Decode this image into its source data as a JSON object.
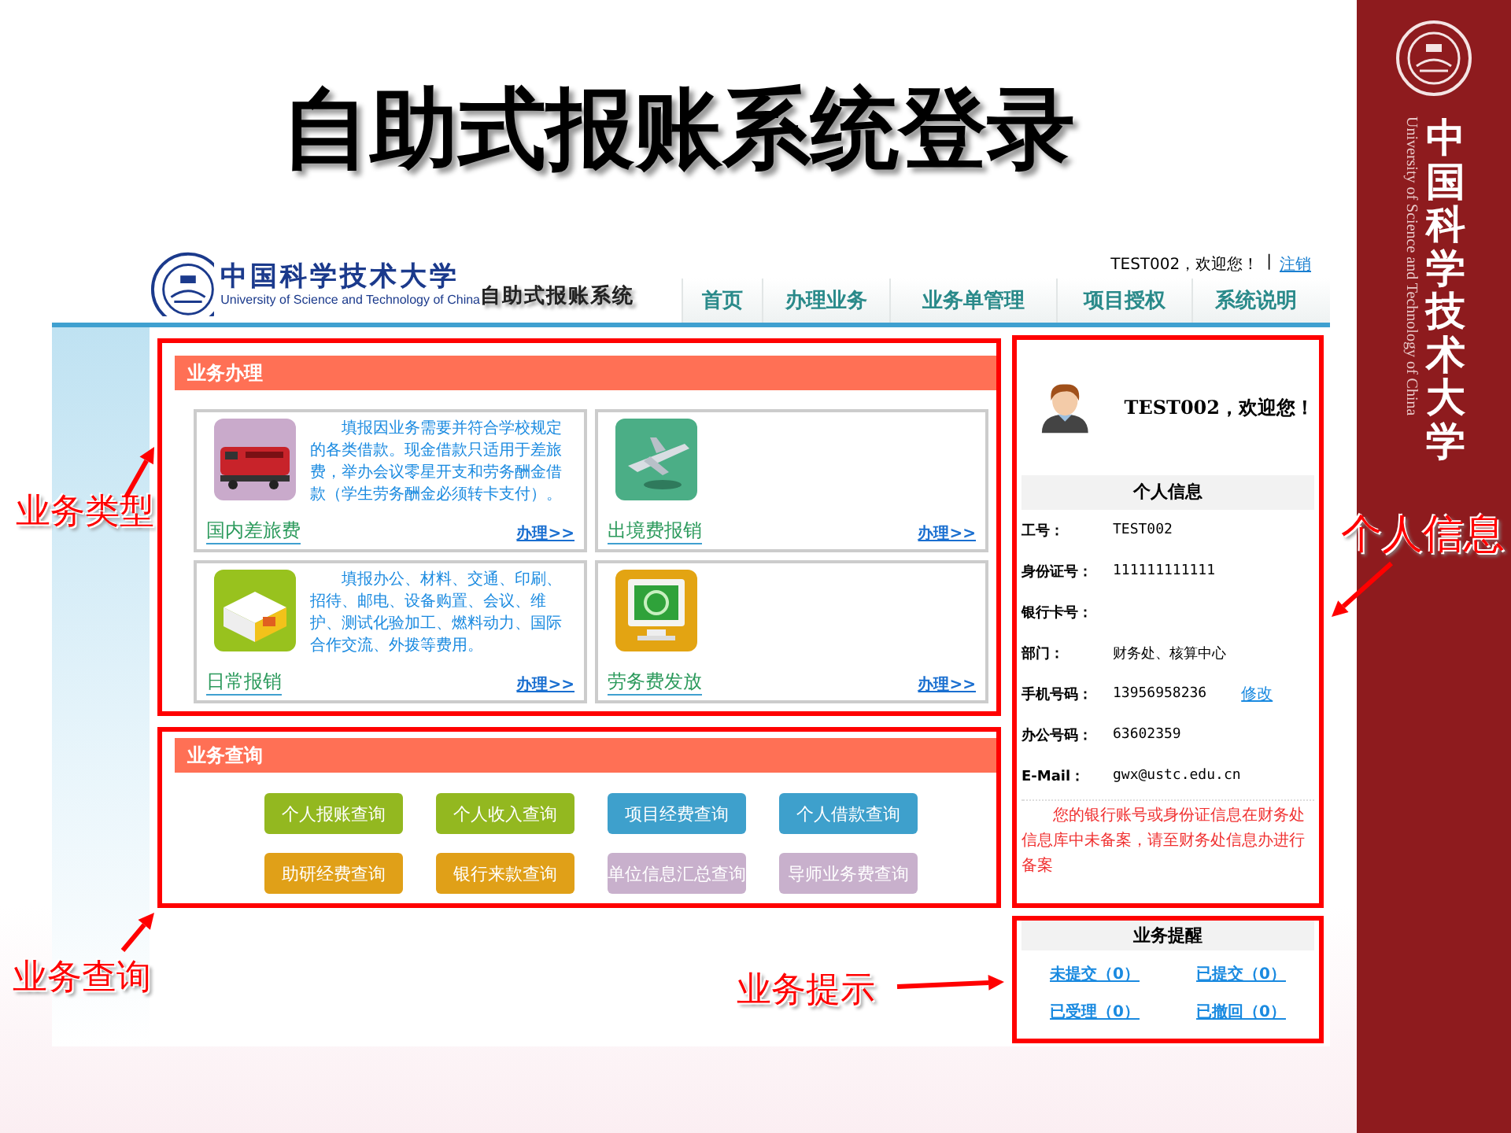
{
  "slide": {
    "title": "自助式报账系统登录"
  },
  "side_band": {
    "university_cn": "中国科学技术大学",
    "university_en": "University of Science and Technology of China"
  },
  "header": {
    "logo_cn": "中国科学技术大学",
    "logo_en": "University of Science and Technology of China",
    "system_name": "自助式报账系统",
    "user_greeting": "TEST002，欢迎您！",
    "separator": "|",
    "logout_link": "注销",
    "nav": [
      {
        "label": "首页"
      },
      {
        "label": "办理业务"
      },
      {
        "label": "业务单管理"
      },
      {
        "label": "项目授权"
      },
      {
        "label": "系统说明"
      }
    ]
  },
  "business_panel": {
    "title": "业务办理",
    "cards": [
      {
        "kind": "train",
        "title": "国内差旅费",
        "description": "填报因业务需要并符合学校规定的各类借款。现金借款只适用于差旅费，举办会议零星开支和劳务酬金借款（学生劳务酬金必须转卡支付）。",
        "action": "办理>>"
      },
      {
        "kind": "plane",
        "title": "出境费报销",
        "action": "办理>>"
      },
      {
        "kind": "box",
        "title": "日常报销",
        "description": "填报办公、材料、交通、印刷、招待、邮电、设备购置、会议、维护、测试化验加工、燃料动力、国际合作交流、外拨等费用。",
        "action": "办理>>"
      },
      {
        "kind": "monitor",
        "title": "劳务费发放",
        "action": "办理>>"
      }
    ]
  },
  "query_panel": {
    "title": "业务查询",
    "buttons": [
      {
        "label": "个人报账查询",
        "color": "#93b820"
      },
      {
        "label": "个人收入查询",
        "color": "#93b820"
      },
      {
        "label": "项目经费查询",
        "color": "#3ea0cc"
      },
      {
        "label": "个人借款查询",
        "color": "#3ea0cc"
      },
      {
        "label": "助研经费查询",
        "color": "#e0a018"
      },
      {
        "label": "银行来款查询",
        "color": "#e0a018"
      },
      {
        "label": "单位信息汇总查询",
        "color": "#c8b0cc"
      },
      {
        "label": "导师业务费查询",
        "color": "#c8b0cc"
      }
    ]
  },
  "profile_panel": {
    "greeting": "TEST002，欢迎您！",
    "section_title": "个人信息",
    "fields": [
      {
        "label": "工号：",
        "value": "TEST002"
      },
      {
        "label": "身份证号：",
        "value": "111111111111"
      },
      {
        "label": "银行卡号："
      },
      {
        "label": "部门：",
        "value": "财务处、核算中心"
      },
      {
        "label": "手机号码：",
        "value": "13956958236",
        "link": "修改"
      },
      {
        "label": "办公号码：",
        "value": "63602359"
      },
      {
        "label": "E-Mail：",
        "value": "gwx@ustc.edu.cn"
      }
    ],
    "notice": "您的银行账号或身份证信息在财务处信息库中未备案，请至财务处信息办进行备案"
  },
  "reminder_panel": {
    "title": "业务提醒",
    "links": [
      "未提交（0）",
      "已提交（0）",
      "已受理（0）",
      "已撤回（0）"
    ]
  },
  "annotations": [
    "业务类型",
    "业务查询",
    "业务提示",
    "个人信息"
  ]
}
